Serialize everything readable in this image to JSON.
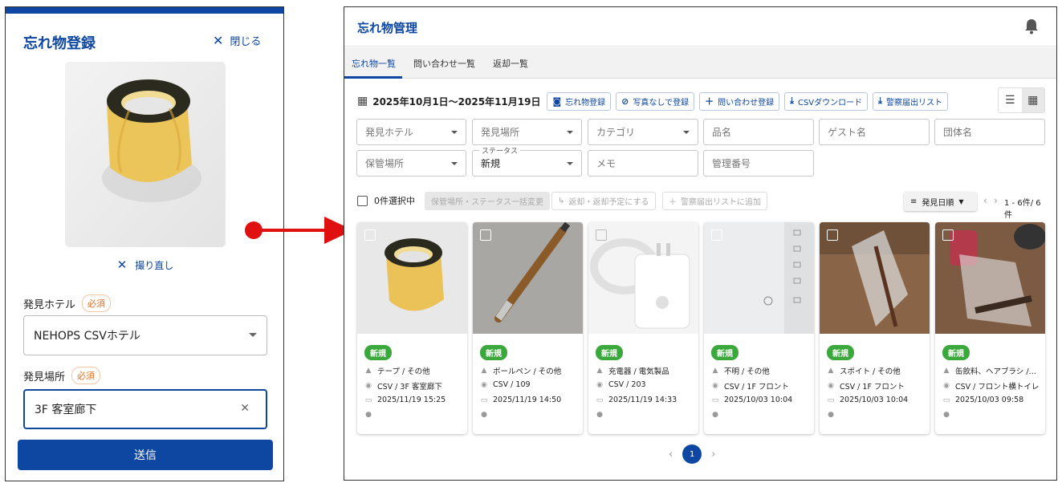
{
  "mobile": {
    "title": "忘れ物登録",
    "close_label": "閉じる",
    "retake_label": "撮り直し",
    "hotel_label": "発見ホテル",
    "hotel_required": "必須",
    "hotel_value": "NEHOPS CSVホテル",
    "place_label": "発見場所",
    "place_required": "必須",
    "place_value": "3F 客室廊下",
    "submit_label": "送信"
  },
  "desktop": {
    "title": "忘れ物管理",
    "tabs": [
      {
        "label": "忘れ物一覧",
        "active": true
      },
      {
        "label": "問い合わせ一覧",
        "active": false
      },
      {
        "label": "返却一覧",
        "active": false
      }
    ],
    "date_range": "2025年10月1日〜2025年11月19日",
    "actions": [
      {
        "icon": "camera-icon",
        "label": "忘れ物登録"
      },
      {
        "icon": "no-photo-icon",
        "label": "写真なしで登録"
      },
      {
        "icon": "plus-icon",
        "label": "問い合わせ登録"
      },
      {
        "icon": "download-icon",
        "label": "CSVダウンロード"
      },
      {
        "icon": "download-icon",
        "label": "警察届出リスト"
      }
    ],
    "filters": {
      "hotel": "発見ホテル",
      "place": "発見場所",
      "category": "カテゴリ",
      "item_name": "品名",
      "guest_name": "ゲスト名",
      "group_name": "団体名",
      "storage": "保管場所",
      "status_legend": "ステータス",
      "status_value": "新規",
      "memo": "メモ",
      "manage_no": "管理番号"
    },
    "selection": {
      "count_label": "0件選択中",
      "bulk_change": "保管場所・ステータス一括変更",
      "mark_return": "返却・返却予定にする",
      "add_police": "警察届出リストに追加"
    },
    "sort_label": "発見日順",
    "page_count": "1 - 6件/ 6件",
    "cards": [
      {
        "status": "新規",
        "category": "テープ / その他",
        "place": "CSV / 3F 客室廊下",
        "date": "2025/11/19 15:25"
      },
      {
        "status": "新規",
        "category": "ボールペン / その他",
        "place": "CSV / 109",
        "date": "2025/11/19 14:50"
      },
      {
        "status": "新規",
        "category": "充電器 / 電気製品",
        "place": "CSV / 203",
        "date": "2025/11/19 14:33"
      },
      {
        "status": "新規",
        "category": "不明 / その他",
        "place": "CSV / 1F フロント",
        "date": "2025/10/03 10:04"
      },
      {
        "status": "新規",
        "category": "スポイト / その他",
        "place": "CSV / 1F フロント",
        "date": "2025/10/03 10:04"
      },
      {
        "status": "新規",
        "category": "缶飲料、ヘアブラシ /…",
        "place": "CSV / フロント横トイレ",
        "date": "2025/10/03 09:58"
      }
    ],
    "pager_page": "1"
  },
  "colors": {
    "brand": "#0d47a1",
    "badge_green": "#3aa83a",
    "arrow_red": "#e01010",
    "required_orange": "#e07020"
  }
}
